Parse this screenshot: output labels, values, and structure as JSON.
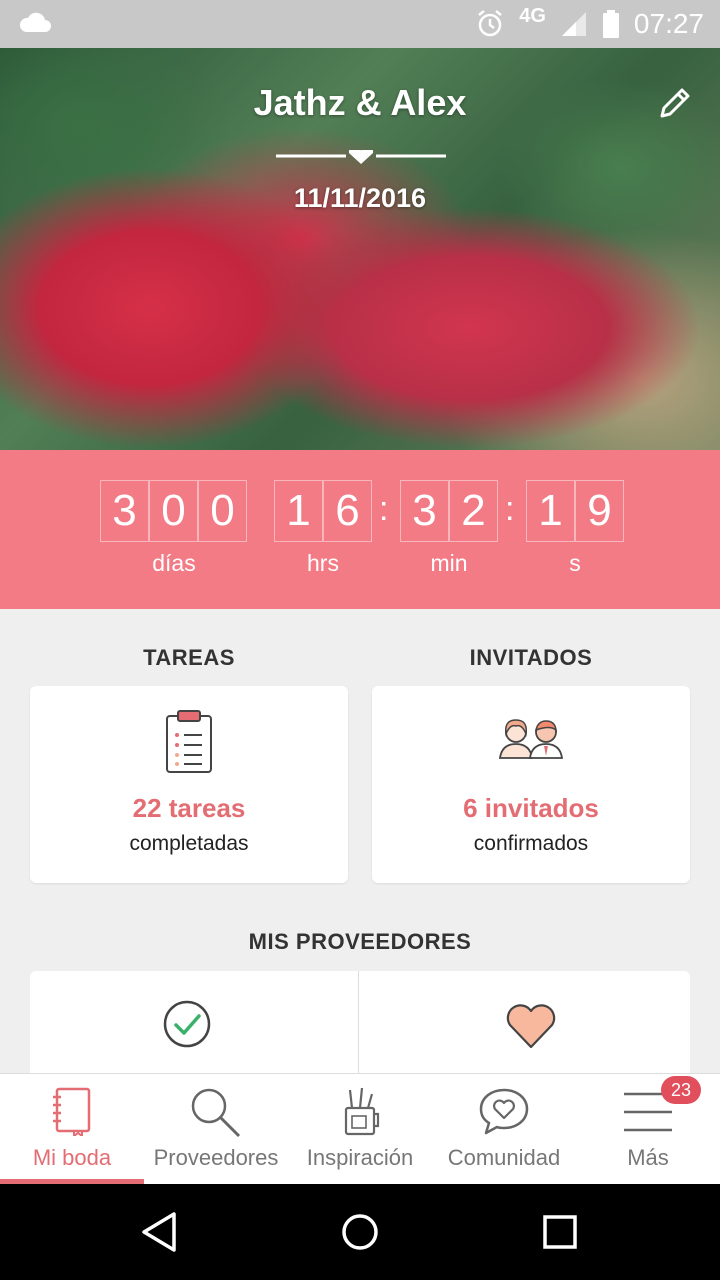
{
  "status_bar": {
    "time": "07:27",
    "network": "4G",
    "icons": [
      "cloud-icon",
      "alarm-icon",
      "signal-icon",
      "battery-icon"
    ]
  },
  "header": {
    "couple_names": "Jathz & Alex",
    "wedding_date": "11/11/2016"
  },
  "countdown": {
    "days": [
      "3",
      "0",
      "0"
    ],
    "hours": [
      "1",
      "6"
    ],
    "minutes": [
      "3",
      "2"
    ],
    "seconds": [
      "1",
      "9"
    ],
    "separator": ":",
    "labels": {
      "days": "días",
      "hours": "hrs",
      "minutes": "min",
      "seconds": "s"
    }
  },
  "tasks": {
    "title": "TAREAS",
    "count": "22 tareas",
    "sub": "completadas"
  },
  "guests": {
    "title": "INVITADOS",
    "count": "6 invitados",
    "sub": "confirmados"
  },
  "vendors": {
    "title": "MIS PROVEEDORES"
  },
  "tabs": [
    {
      "label": "Mi boda",
      "icon": "notebook-icon",
      "active": true
    },
    {
      "label": "Proveedores",
      "icon": "search-icon",
      "active": false
    },
    {
      "label": "Inspiración",
      "icon": "art-supplies-icon",
      "active": false
    },
    {
      "label": "Comunidad",
      "icon": "chat-heart-icon",
      "active": false
    },
    {
      "label": "Más",
      "icon": "menu-icon",
      "active": false
    }
  ],
  "more_badge": "23",
  "colors": {
    "accent": "#e36d73",
    "countdown_bg": "#f27b86",
    "badge": "#e14e5c"
  }
}
